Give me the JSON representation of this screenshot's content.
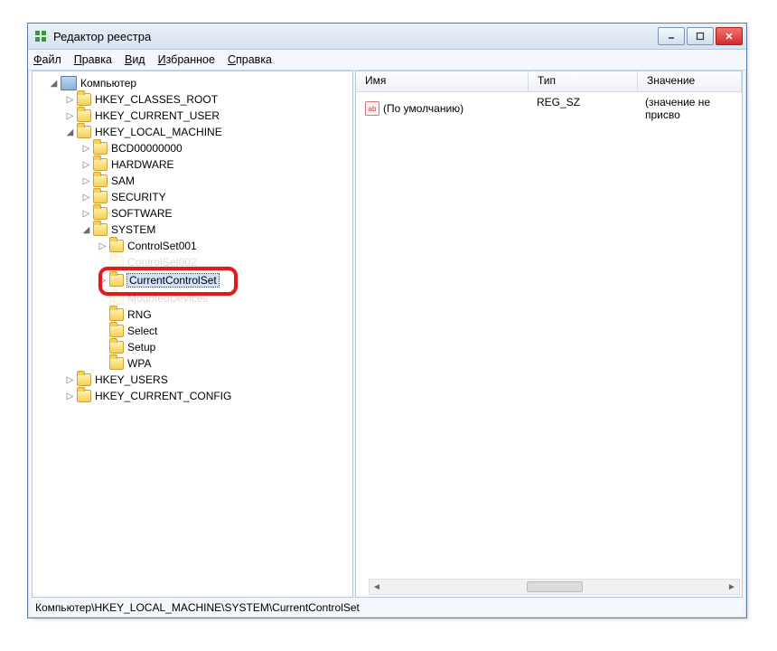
{
  "window": {
    "title": "Редактор реестра"
  },
  "menu": [
    "Файл",
    "Правка",
    "Вид",
    "Избранное",
    "Справка"
  ],
  "tree": {
    "computer": "Компьютер",
    "hkcr": "HKEY_CLASSES_ROOT",
    "hkcu": "HKEY_CURRENT_USER",
    "hklm": "HKEY_LOCAL_MACHINE",
    "hklm_children": [
      "BCD00000000",
      "HARDWARE",
      "SAM",
      "SECURITY",
      "SOFTWARE",
      "SYSTEM"
    ],
    "system_children": [
      "ControlSet001",
      "ControlSet002",
      "CurrentControlSet",
      "MountedDevices",
      "RNG",
      "Select",
      "Setup",
      "WPA"
    ],
    "hku": "HKEY_USERS",
    "hkcc": "HKEY_CURRENT_CONFIG",
    "selected": "CurrentControlSet"
  },
  "list": {
    "columns": [
      "Имя",
      "Тип",
      "Значение"
    ],
    "rows": [
      {
        "name": "(По умолчанию)",
        "type": "REG_SZ",
        "value": "(значение не присво"
      }
    ]
  },
  "status": {
    "path": "Компьютер\\HKEY_LOCAL_MACHINE\\SYSTEM\\CurrentControlSet"
  },
  "colors": {
    "highlight": "#e21a1a",
    "selection": "#d0e3fb"
  }
}
